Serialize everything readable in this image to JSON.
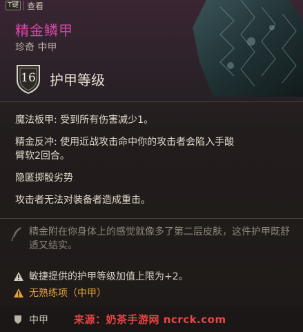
{
  "hotkey": {
    "key": "T键",
    "label": "查看"
  },
  "item": {
    "name": "精金鳞甲",
    "rarity_type": "珍奇 中甲",
    "armor_class": "16",
    "armor_class_label": "护甲等级"
  },
  "properties": [
    "魔法板甲: 受到所有伤害减少1。",
    "精金反冲: 使用近战攻击命中你的攻击者会陷入手酸臂软2回合。",
    "隐匿掷骰劣势",
    "攻击者无法对装备者造成重击。"
  ],
  "flavor": "精金附在你身体上的感觉就像多了第二层皮肤，这件护甲既舒适又结实。",
  "notes": [
    {
      "text": "敏捷提供的护甲等级加值上限为+2。",
      "color": "#d8cfc3",
      "icon": "warning-icon"
    },
    {
      "text": "无熟练项（中甲）",
      "color": "#e0a23a",
      "icon": "warning-icon"
    }
  ],
  "footer": {
    "category": "中甲"
  },
  "watermark": "来源：奶茶手游网 ncrck.com",
  "colors": {
    "item_name": "#d34aa7",
    "warning_orange": "#e0a23a",
    "watermark": "#e64545"
  }
}
